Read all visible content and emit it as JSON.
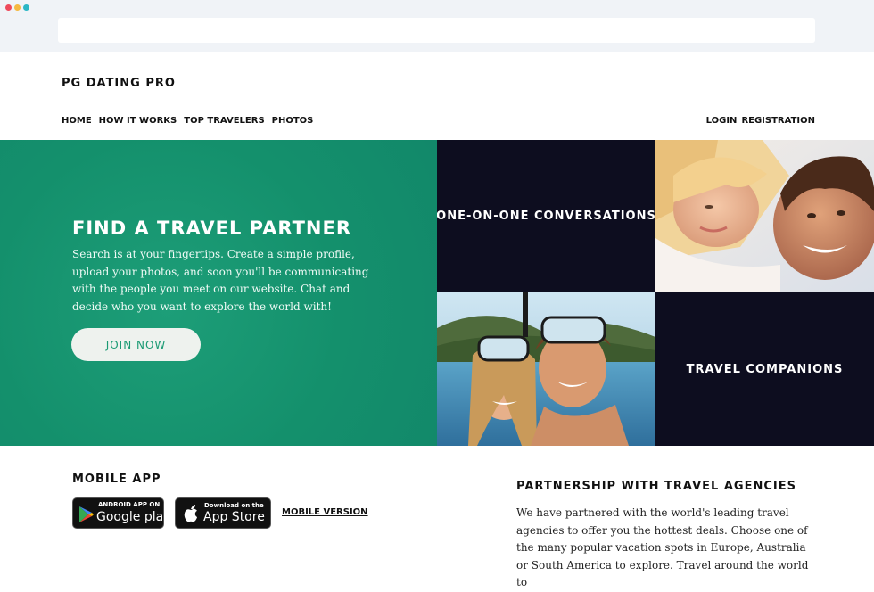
{
  "colors": {
    "hero_green": "#14906c",
    "tile_dark": "#0d0d1f",
    "dot_red": "#ee4a5b",
    "dot_yellow": "#f5b942",
    "dot_teal": "#2bb7c5"
  },
  "header": {
    "brand": "PG DATING PRO",
    "nav": [
      "HOME",
      "HOW IT WORKS",
      "TOP TRAVELERS",
      "PHOTOS"
    ],
    "auth": [
      "LOGIN",
      "REGISTRATION"
    ]
  },
  "hero": {
    "title": "FIND A TRAVEL PARTNER",
    "text": "Search is at your fingertips. Create a simple profile, upload your photos, and soon you'll be communicating with the people you meet on our website. Chat and decide who you want to explore the world with!",
    "button": "JOIN NOW"
  },
  "tiles": {
    "conversations": "ONE-ON-ONE CONVERSATIONS",
    "companions": "TRAVEL COMPANIONS"
  },
  "mobile": {
    "title": "MOBILE APP",
    "google_small": "ANDROID APP ON",
    "google_big": "Google play",
    "apple_small": "Download on the",
    "apple_big": "App Store",
    "mobile_link": "MOBILE VERSION"
  },
  "partnership": {
    "title": "PARTNERSHIP WITH TRAVEL AGENCIES",
    "text": "We have partnered with the world's leading travel agencies to offer you the hottest deals. Choose one of the many popular vacation spots in Europe, Australia or South America to explore. Travel around the world to"
  }
}
